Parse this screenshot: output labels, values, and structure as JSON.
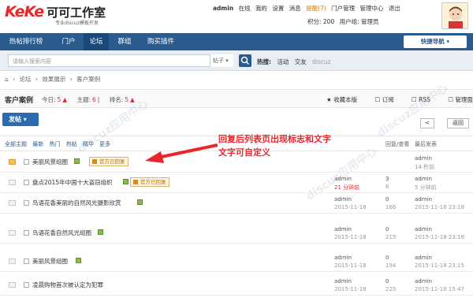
{
  "brand": {
    "logo": "KeKe",
    "name": "可可工作室",
    "tagline": "专业discuz模板开发"
  },
  "user": {
    "name": "admin",
    "status": "在线",
    "links": [
      "我的",
      "设置",
      "消息"
    ],
    "alert": "提醒(7)",
    "more": [
      "门户管理",
      "管理中心",
      "退出"
    ],
    "points_label": "积分: 200",
    "group_label": "用户组: 管理员"
  },
  "nav": {
    "items": [
      "热帖排行榜",
      "门户",
      "论坛",
      "群组",
      "购买插件"
    ],
    "quick": "快捷导航"
  },
  "search": {
    "placeholder": "请输入搜索内容",
    "type": "帖子",
    "hot_label": "热搜:",
    "hot": [
      "活动",
      "交友",
      "discuz"
    ]
  },
  "breadcrumb": [
    "论坛",
    "效果展示",
    "客户案例"
  ],
  "forum": {
    "title": "客户案例",
    "today_label": "今日:",
    "today": "5",
    "topics_label": "主题:",
    "topics": "6",
    "rank_label": "排名:",
    "rank": "5",
    "actions": [
      "收藏本版",
      "订阅",
      "RSS",
      "管理面板"
    ]
  },
  "buttons": {
    "post": "发帖",
    "back": "返回",
    "prev": "<"
  },
  "filter": {
    "items": [
      "全部主题",
      "最新",
      "热门",
      "热帖",
      "精华",
      "更多"
    ],
    "col_replies": "回复/查看",
    "col_last": "最后发表"
  },
  "annotation": {
    "line1": "回复后列表页出现标志和文字",
    "line2": "文字可自定义"
  },
  "rows": [
    {
      "title": "美丽风景组图",
      "badge": "官方已回复",
      "author": "",
      "date": "",
      "replies": "",
      "views": "",
      "last_user": "admin",
      "last_time": "14 秒前",
      "folder": true
    },
    {
      "title": "盘点2015年中国十大盗窃组织",
      "badge": "官方已回复",
      "author": "admin",
      "date": "21 分钟前",
      "replies": "3",
      "views": "6",
      "last_user": "admin",
      "last_time": "5 分钟前",
      "folder": false
    },
    {
      "title": "鸟语花香美丽的自然风光摄影欣赏",
      "badge": "",
      "author": "admin",
      "date": "2015-11-18",
      "replies": "0",
      "views": "166",
      "last_user": "admin",
      "last_time": "2015-11-18 23:18",
      "folder": false
    },
    {
      "title": "鸟语花香自然风光组图",
      "badge": "",
      "author": "admin",
      "date": "2015-11-18",
      "replies": "0",
      "views": "215",
      "last_user": "admin",
      "last_time": "2015-11-18 23:16",
      "folder": false
    },
    {
      "title": "美丽风景组图",
      "badge": "",
      "author": "admin",
      "date": "2015-11-18",
      "replies": "0",
      "views": "194",
      "last_user": "admin",
      "last_time": "2015-11-18 23:15",
      "folder": false
    },
    {
      "title": "凌晨购物首次被认定为犯罪",
      "badge": "",
      "author": "admin",
      "date": "2015-11-18",
      "replies": "0",
      "views": "225",
      "last_user": "admin",
      "last_time": "2015-11-18 15:47",
      "folder": false
    }
  ]
}
